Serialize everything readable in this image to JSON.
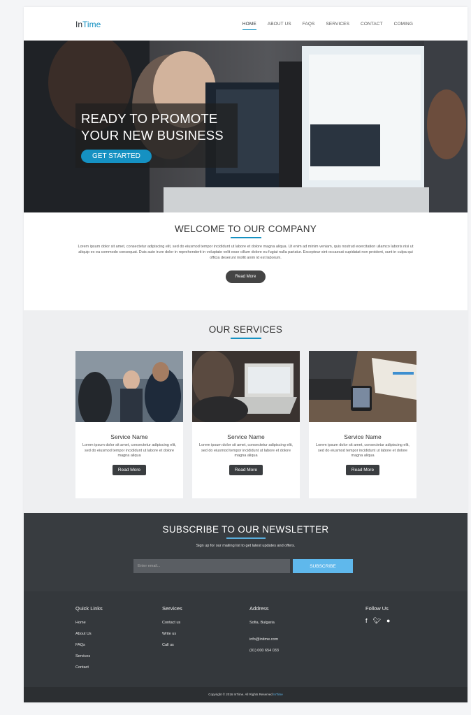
{
  "nav": {
    "logo_prefix": "In",
    "logo_suffix": "Time",
    "items": [
      "HOME",
      "ABOUT US",
      "FAQS",
      "SERVICES",
      "CONTACT",
      "COMING"
    ]
  },
  "hero": {
    "title_line1": "READY TO PROMOTE",
    "title_line2": "YOUR NEW BUSINESS",
    "button": "GET STARTED"
  },
  "welcome": {
    "title": "WELCOME TO OUR COMPANY",
    "text": "Lorem ipsum dolor sit amet, consectetur adipiscing elit, sed do eiusmod tempor incididunt ut labore et dolore magna aliqua. Ut enim ad minim veniam, quis nostrud exercitation ullamco laboris nisi ut aliquip ex ea commodo consequat. Duis aute irure dolor in reprehenderit in voluptate velit esse cillum dolore eu fugiat nulla pariatur. Excepteur sint occaecat cupidatat non proident, sunt in culpa qui officia deserunt mollit anim id est laborum.",
    "button": "Read More"
  },
  "services": {
    "title": "OUR SERVICES",
    "cards": [
      {
        "title": "Service Name",
        "text": "Lorem ipsum dolor sit amet, consectetur adipiscing elit, sed do eiusmod tempor incididunt ut labore et dolore magna aliqua",
        "button": "Read More"
      },
      {
        "title": "Service Name",
        "text": "Lorem ipsum dolor sit amet, consectetur adipiscing elit, sed do eiusmod tempor incididunt ut labore et dolore magna aliqua",
        "button": "Read More"
      },
      {
        "title": "Service Name",
        "text": "Lorem ipsum dolor sit amet, consectetur adipiscing elit, sed do eiusmod tempor incididunt ut labore et dolore magna aliqua",
        "button": "Read More"
      }
    ]
  },
  "newsletter": {
    "title": "SUBSCRIBE TO OUR NEWSLETTER",
    "subtitle": "Sign up for our mailing list to get latest updates and offers.",
    "placeholder": "Enter email...",
    "button": "SUBSCRIBE"
  },
  "footer": {
    "quick_links": {
      "title": "Quick Links",
      "items": [
        "Home",
        "About Us",
        "FAQs",
        "Services",
        "Contact"
      ]
    },
    "services": {
      "title": "Services",
      "items": [
        "Contact us",
        "Write us",
        "Call us"
      ]
    },
    "address": {
      "title": "Address",
      "location": "Sofia, Bulgaria",
      "email": "info@intime.com",
      "phone": "(01) 000 654 033"
    },
    "follow": {
      "title": "Follow Us",
      "icons": [
        "facebook-icon",
        "twitter-icon",
        "github-icon"
      ]
    },
    "copyright_prefix": "Copyright © 2016 InTime. All Rights Reserved",
    "copyright_link": "InTime"
  },
  "colors": {
    "accent": "#1591c2",
    "newsletter_bg": "#383c40",
    "footer_bg": "#34383c",
    "subscribe_btn": "#5fb8ec"
  }
}
